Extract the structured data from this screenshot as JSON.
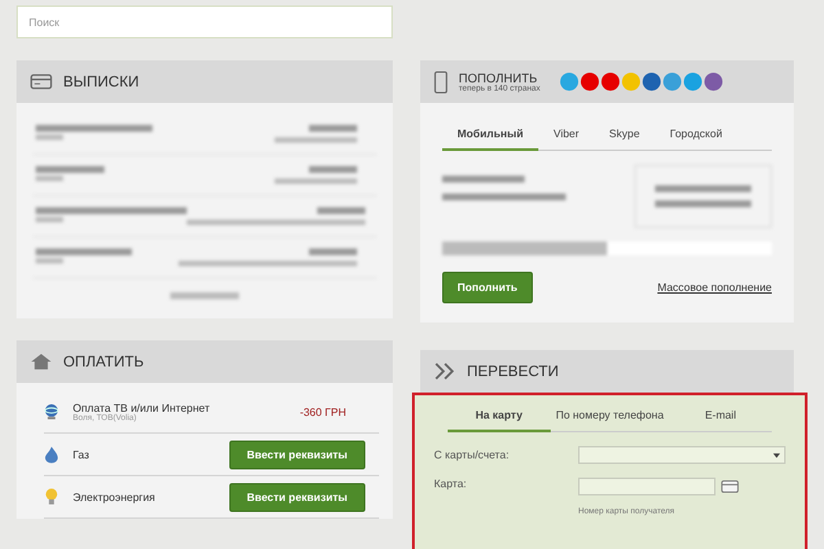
{
  "search": {
    "placeholder": "Поиск"
  },
  "statements": {
    "title": "ВЫПИСКИ"
  },
  "topup": {
    "title": "ПОПОЛНИТЬ",
    "subtitle": "теперь в 140 странах",
    "tabs": [
      {
        "label": "Мобильный",
        "selected": true
      },
      {
        "label": "Viber",
        "selected": false
      },
      {
        "label": "Skype",
        "selected": false
      },
      {
        "label": "Городской",
        "selected": false
      }
    ],
    "button": "Пополнить",
    "link": "Массовое пополнение"
  },
  "pay": {
    "title": "ОПЛАТИТЬ",
    "items": [
      {
        "kind": "amount",
        "name": "Оплата ТВ и/или Интернет",
        "sub": "Воля, ТОВ(Volia)",
        "amount": "-360 ГРН"
      },
      {
        "kind": "button",
        "name": "Газ",
        "button": "Ввести реквизиты"
      },
      {
        "kind": "button",
        "name": "Электроэнергия",
        "button": "Ввести реквизиты"
      }
    ]
  },
  "transfer": {
    "title": "ПЕРЕВЕСТИ",
    "tabs": [
      {
        "label": "На карту",
        "selected": true
      },
      {
        "label": "По номеру телефона",
        "selected": false
      },
      {
        "label": "E-mail",
        "selected": false
      }
    ],
    "from_label": "С карты/счета:",
    "card_label": "Карта:",
    "card_hint": "Номер карты получателя"
  }
}
